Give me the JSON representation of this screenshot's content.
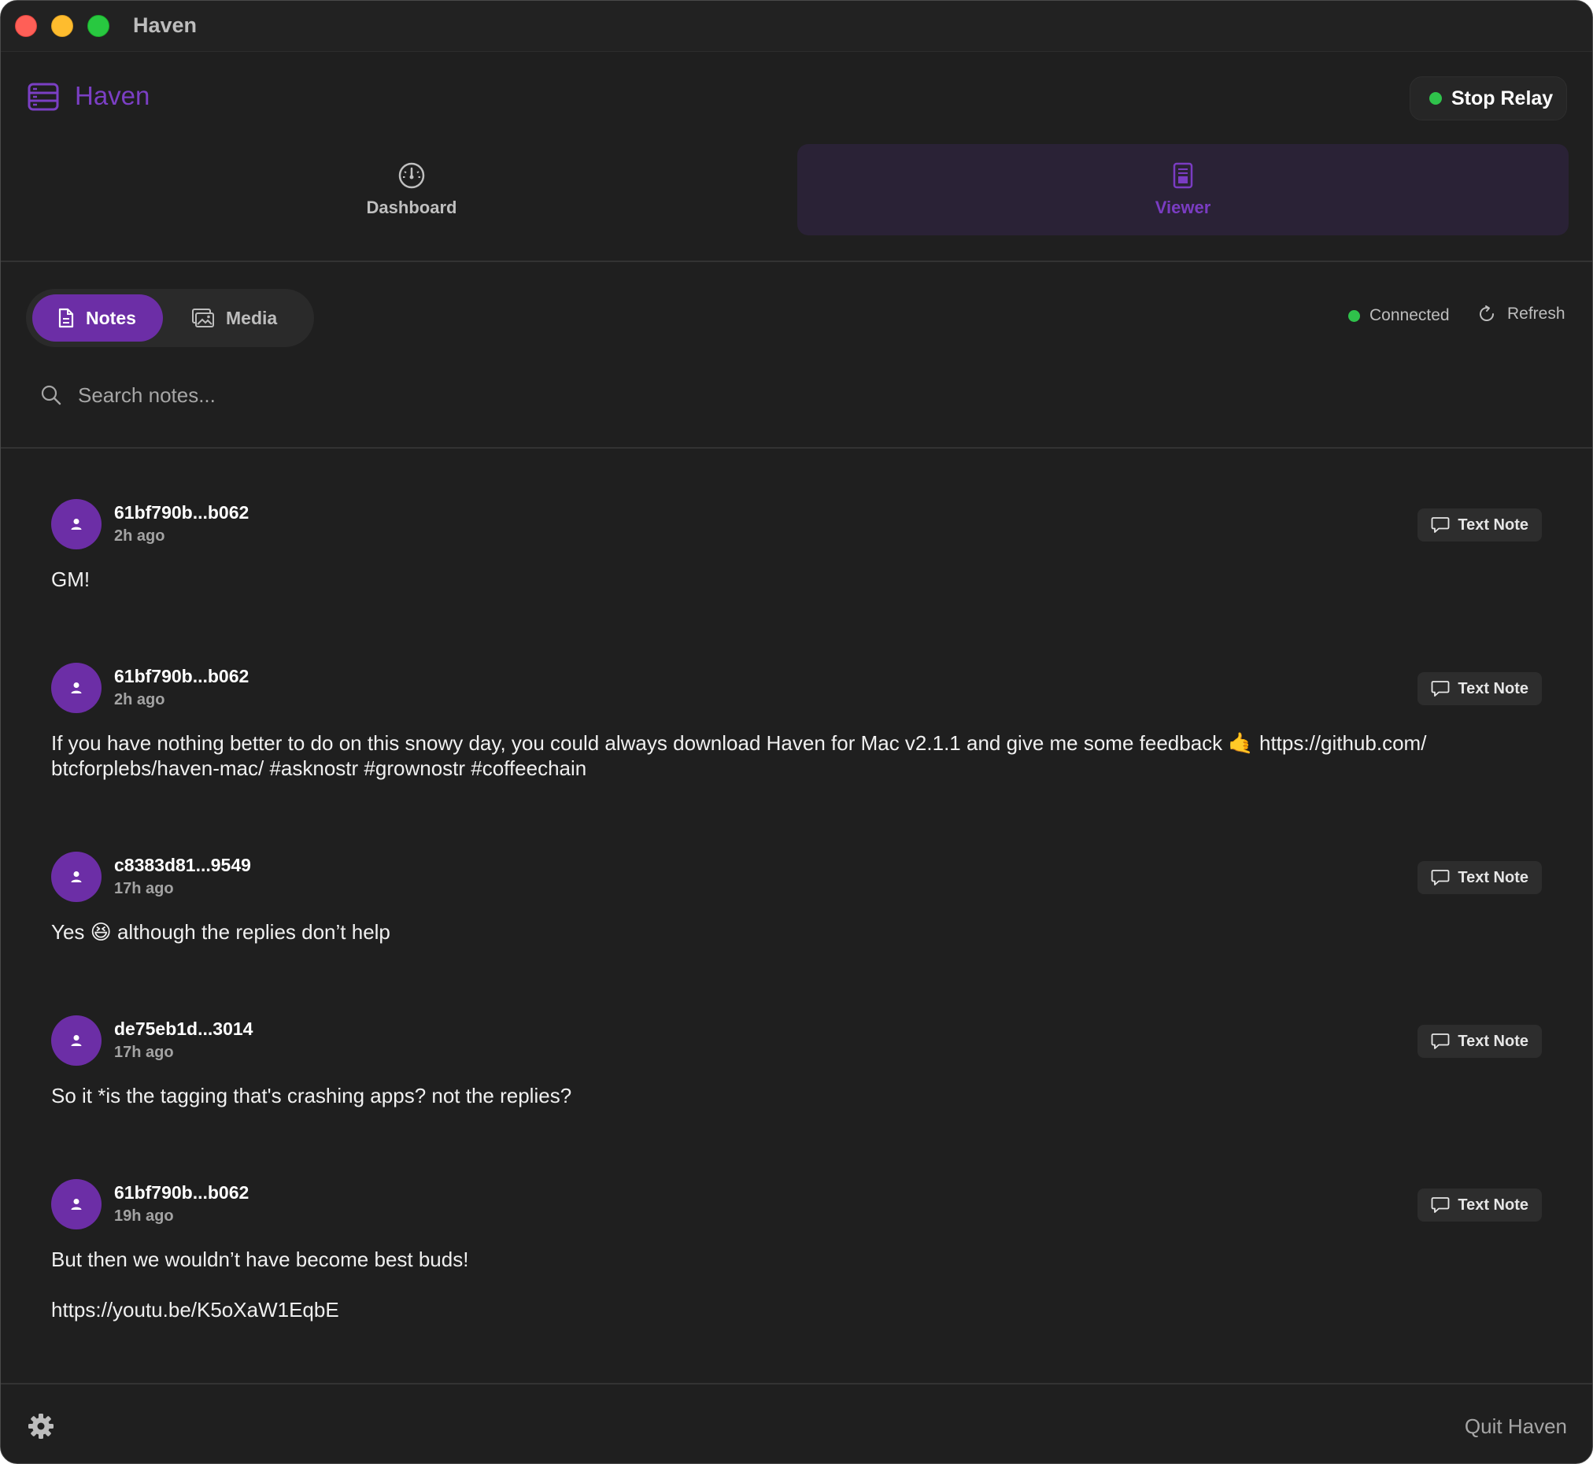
{
  "window": {
    "title": "Haven"
  },
  "header": {
    "app_name": "Haven",
    "stop_relay_label": "Stop Relay",
    "relay_status_color": "#2fc24b",
    "accent_color": "#7b3fc4"
  },
  "main_tabs": [
    {
      "label": "Dashboard",
      "icon": "gauge-icon",
      "selected": false
    },
    {
      "label": "Viewer",
      "icon": "document-icon",
      "selected": true
    }
  ],
  "viewer": {
    "segments": [
      {
        "label": "Notes",
        "icon": "document-icon",
        "selected": true
      },
      {
        "label": "Media",
        "icon": "photos-icon",
        "selected": false
      }
    ],
    "connection_status": "Connected",
    "refresh_label": "Refresh",
    "search": {
      "placeholder": "Search notes...",
      "value": ""
    }
  },
  "notes": [
    {
      "author": "61bf790b...b062",
      "time": "2h ago",
      "kind": "Text Note",
      "content": "GM!"
    },
    {
      "author": "61bf790b...b062",
      "time": "2h ago",
      "kind": "Text Note",
      "content": "If you have nothing better to do on this snowy day, you could always download Haven for Mac v2.1.1 and give me some feedback 🤙 https://github.com/\nbtcforplebs/haven-mac/ #asknostr #grownostr #coffeechain"
    },
    {
      "author": "c8383d81...9549",
      "time": "17h ago",
      "kind": "Text Note",
      "content": "Yes 😆 although the replies don’t help"
    },
    {
      "author": "de75eb1d...3014",
      "time": "17h ago",
      "kind": "Text Note",
      "content": "So it *is the tagging that's crashing apps? not the replies?"
    },
    {
      "author": "61bf790b...b062",
      "time": "19h ago",
      "kind": "Text Note",
      "content": "But then we wouldn’t have become best buds!\n\nhttps://youtu.be/K5oXaW1EqbE"
    }
  ],
  "footer": {
    "settings_icon": "gear-icon",
    "quit_label": "Quit Haven"
  }
}
